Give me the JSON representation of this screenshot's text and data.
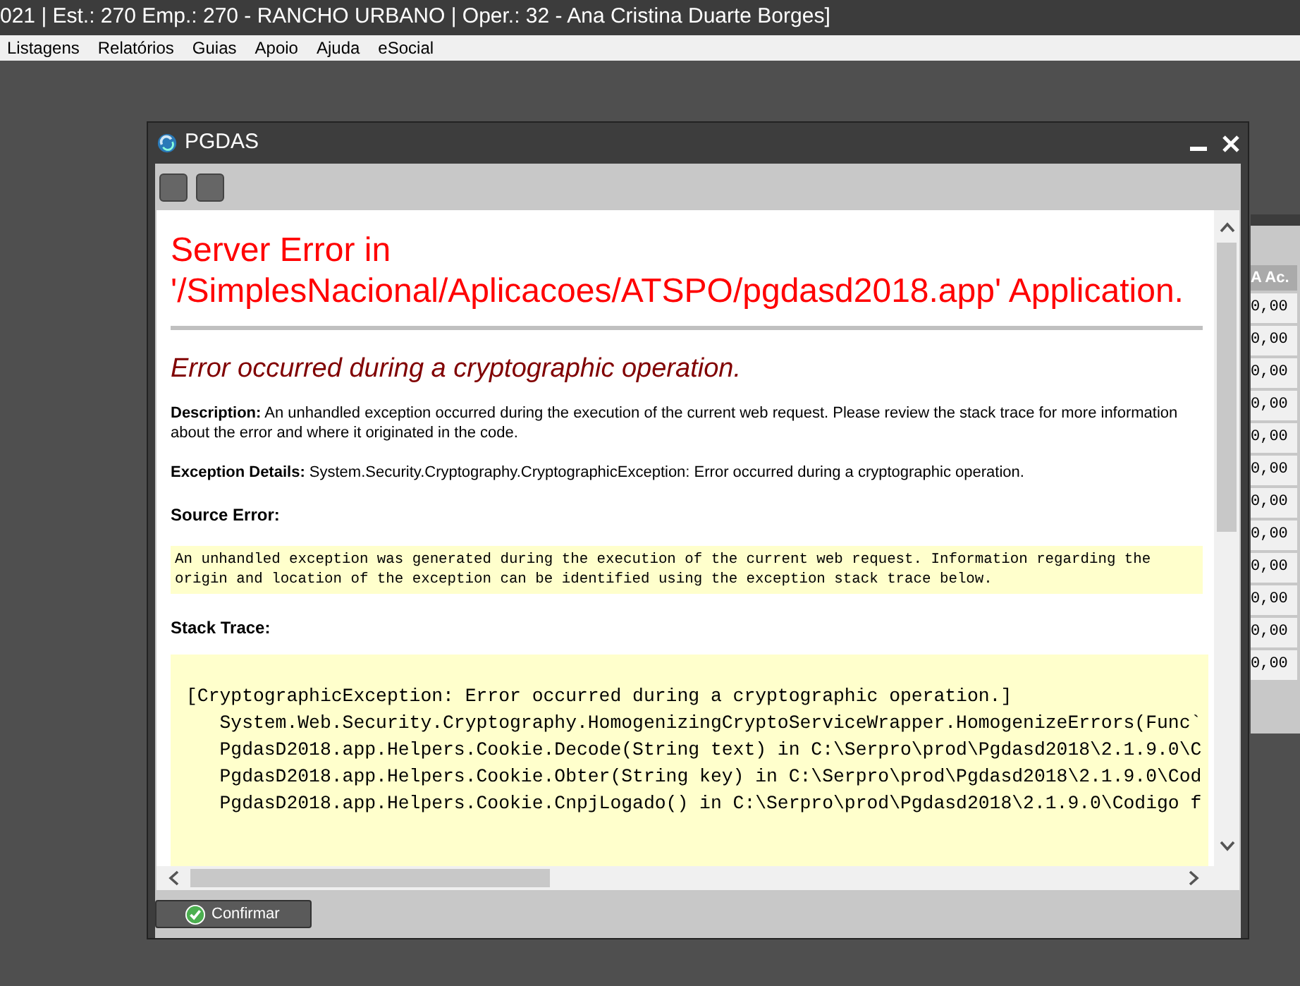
{
  "app_title": "021 | Est.: 270 Emp.: 270 - RANCHO URBANO | Oper.: 32 - Ana Cristina Duarte Borges]",
  "menu": [
    "Listagens",
    "Relatórios",
    "Guias",
    "Apoio",
    "Ajuda",
    "eSocial"
  ],
  "background_grid": {
    "header": "A Ac.",
    "cells": [
      "0,00",
      "0,00",
      "0,00",
      "0,00",
      "0,00",
      "0,00",
      "0,00",
      "0,00",
      "0,00",
      "0,00",
      "0,00",
      "0,00"
    ]
  },
  "dialog": {
    "title": "PGDAS",
    "error_page": {
      "heading": "Server Error in '/SimplesNacional/Aplicacoes/ATSPO/pgdasd2018.app' Application.",
      "subheading": "Error occurred during a cryptographic operation.",
      "description": "**Description:** An unhandled exception occurred during the execution of the current web request. Please review the stack trace for more information about the error and where it originated in the code.",
      "exception_details": "**Exception Details:** System.Security.Cryptography.CryptographicException: Error occurred during a cryptographic operation.",
      "source_error_label": "Source Error:",
      "source_error": "An unhandled exception was generated during the execution of the current web request. Information regarding the origin and location of the exception can be identified using the exception stack trace below.",
      "stack_trace_label": "Stack Trace:",
      "stack_trace": [
        "[CryptographicException: Error occurred during a cryptographic operation.]",
        "   System.Web.Security.Cryptography.HomogenizingCryptoServiceWrapper.HomogenizeErrors(Func`",
        "   PgdasD2018.app.Helpers.Cookie.Decode(String text) in C:\\Serpro\\prod\\Pgdasd2018\\2.1.9.0\\C",
        "   PgdasD2018.app.Helpers.Cookie.Obter(String key) in C:\\Serpro\\prod\\Pgdasd2018\\2.1.9.0\\Cod",
        "   PgdasD2018.app.Helpers.Cookie.CnpjLogado() in C:\\Serpro\\prod\\Pgdasd2018\\2.1.9.0\\Codigo f"
      ]
    },
    "confirm_button": "Confirmar"
  }
}
